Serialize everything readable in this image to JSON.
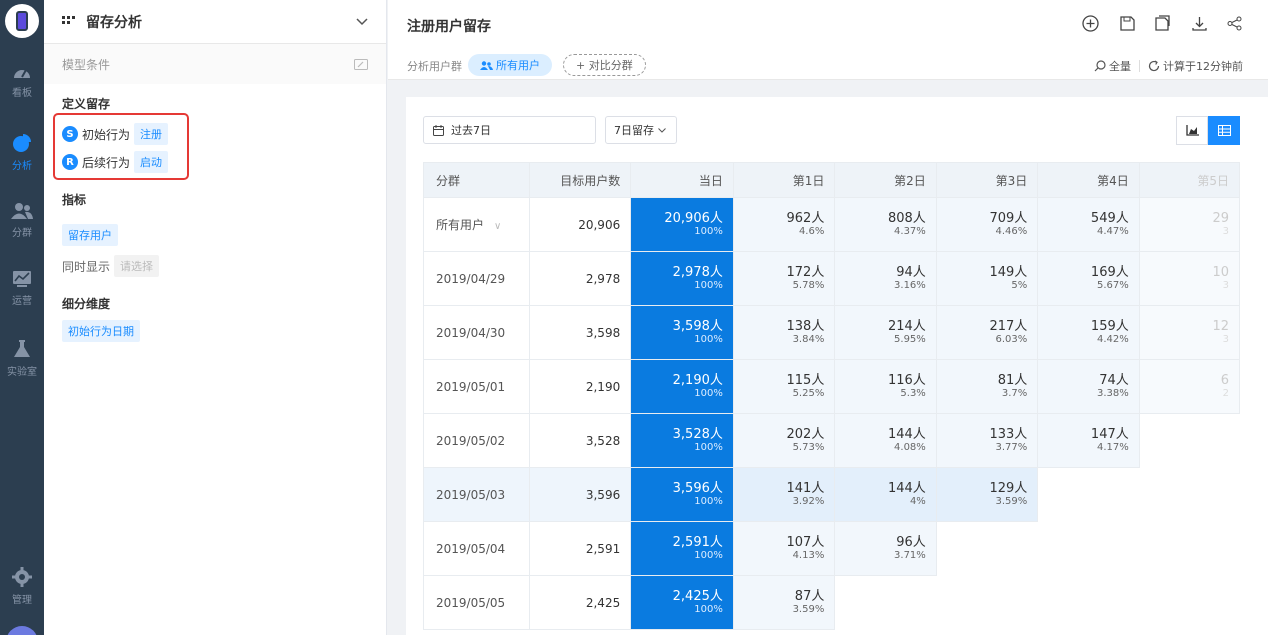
{
  "nav": {
    "items": [
      {
        "label": "看板",
        "icon": "gauge-icon"
      },
      {
        "label": "分析",
        "icon": "pie-chart-icon"
      },
      {
        "label": "分群",
        "icon": "users-icon"
      },
      {
        "label": "运营",
        "icon": "monitor-chart-icon"
      },
      {
        "label": "实验室",
        "icon": "flask-icon"
      },
      {
        "label": "管理",
        "icon": "gear-icon"
      }
    ]
  },
  "panel": {
    "title": "留存分析",
    "model_conditions": "模型条件",
    "define_retention": "定义留存",
    "initial_action": {
      "badge": "S",
      "label": "初始行为",
      "value": "注册"
    },
    "subsequent_action": {
      "badge": "R",
      "label": "后续行为",
      "value": "启动"
    },
    "metrics_title": "指标",
    "metric_tag": "留存用户",
    "also_show_label": "同时显示",
    "also_show_placeholder": "请选择",
    "dimension_title": "细分维度",
    "dimension_tag": "初始行为日期"
  },
  "main": {
    "title": "注册用户留存",
    "group_label": "分析用户群",
    "group_chip": "所有用户",
    "add_compare": "+ 对比分群",
    "scope": "全量",
    "computed": "计算于12分钟前",
    "date_range": "过去7日",
    "retention_select": "7日留存"
  },
  "table": {
    "headers": [
      "分群",
      "目标用户数",
      "当日",
      "第1日",
      "第2日",
      "第3日",
      "第4日",
      "第5日"
    ],
    "rows": [
      {
        "group": "所有用户",
        "target": "20,906",
        "cells": [
          [
            "20,906人",
            "100%"
          ],
          [
            "962人",
            "4.6%"
          ],
          [
            "808人",
            "4.37%"
          ],
          [
            "709人",
            "4.46%"
          ],
          [
            "549人",
            "4.47%"
          ],
          [
            "29",
            "3"
          ]
        ]
      },
      {
        "group": "2019/04/29",
        "target": "2,978",
        "cells": [
          [
            "2,978人",
            "100%"
          ],
          [
            "172人",
            "5.78%"
          ],
          [
            "94人",
            "3.16%"
          ],
          [
            "149人",
            "5%"
          ],
          [
            "169人",
            "5.67%"
          ],
          [
            "10",
            "3"
          ]
        ]
      },
      {
        "group": "2019/04/30",
        "target": "3,598",
        "cells": [
          [
            "3,598人",
            "100%"
          ],
          [
            "138人",
            "3.84%"
          ],
          [
            "214人",
            "5.95%"
          ],
          [
            "217人",
            "6.03%"
          ],
          [
            "159人",
            "4.42%"
          ],
          [
            "12",
            "3"
          ]
        ]
      },
      {
        "group": "2019/05/01",
        "target": "2,190",
        "cells": [
          [
            "2,190人",
            "100%"
          ],
          [
            "115人",
            "5.25%"
          ],
          [
            "116人",
            "5.3%"
          ],
          [
            "81人",
            "3.7%"
          ],
          [
            "74人",
            "3.38%"
          ],
          [
            "6",
            "2"
          ]
        ]
      },
      {
        "group": "2019/05/02",
        "target": "3,528",
        "cells": [
          [
            "3,528人",
            "100%"
          ],
          [
            "202人",
            "5.73%"
          ],
          [
            "144人",
            "4.08%"
          ],
          [
            "133人",
            "3.77%"
          ],
          [
            "147人",
            "4.17%"
          ]
        ]
      },
      {
        "group": "2019/05/03",
        "target": "3,596",
        "cells": [
          [
            "3,596人",
            "100%"
          ],
          [
            "141人",
            "3.92%"
          ],
          [
            "144人",
            "4%"
          ],
          [
            "129人",
            "3.59%"
          ]
        ]
      },
      {
        "group": "2019/05/04",
        "target": "2,591",
        "cells": [
          [
            "2,591人",
            "100%"
          ],
          [
            "107人",
            "4.13%"
          ],
          [
            "96人",
            "3.71%"
          ]
        ]
      },
      {
        "group": "2019/05/05",
        "target": "2,425",
        "cells": [
          [
            "2,425人",
            "100%"
          ],
          [
            "87人",
            "3.59%"
          ]
        ]
      }
    ]
  },
  "colors": {
    "accent": "#1a8cff",
    "day0": "#0a7be0",
    "nav_bg": "#2c3e50",
    "highlight_box": "#e53935"
  }
}
